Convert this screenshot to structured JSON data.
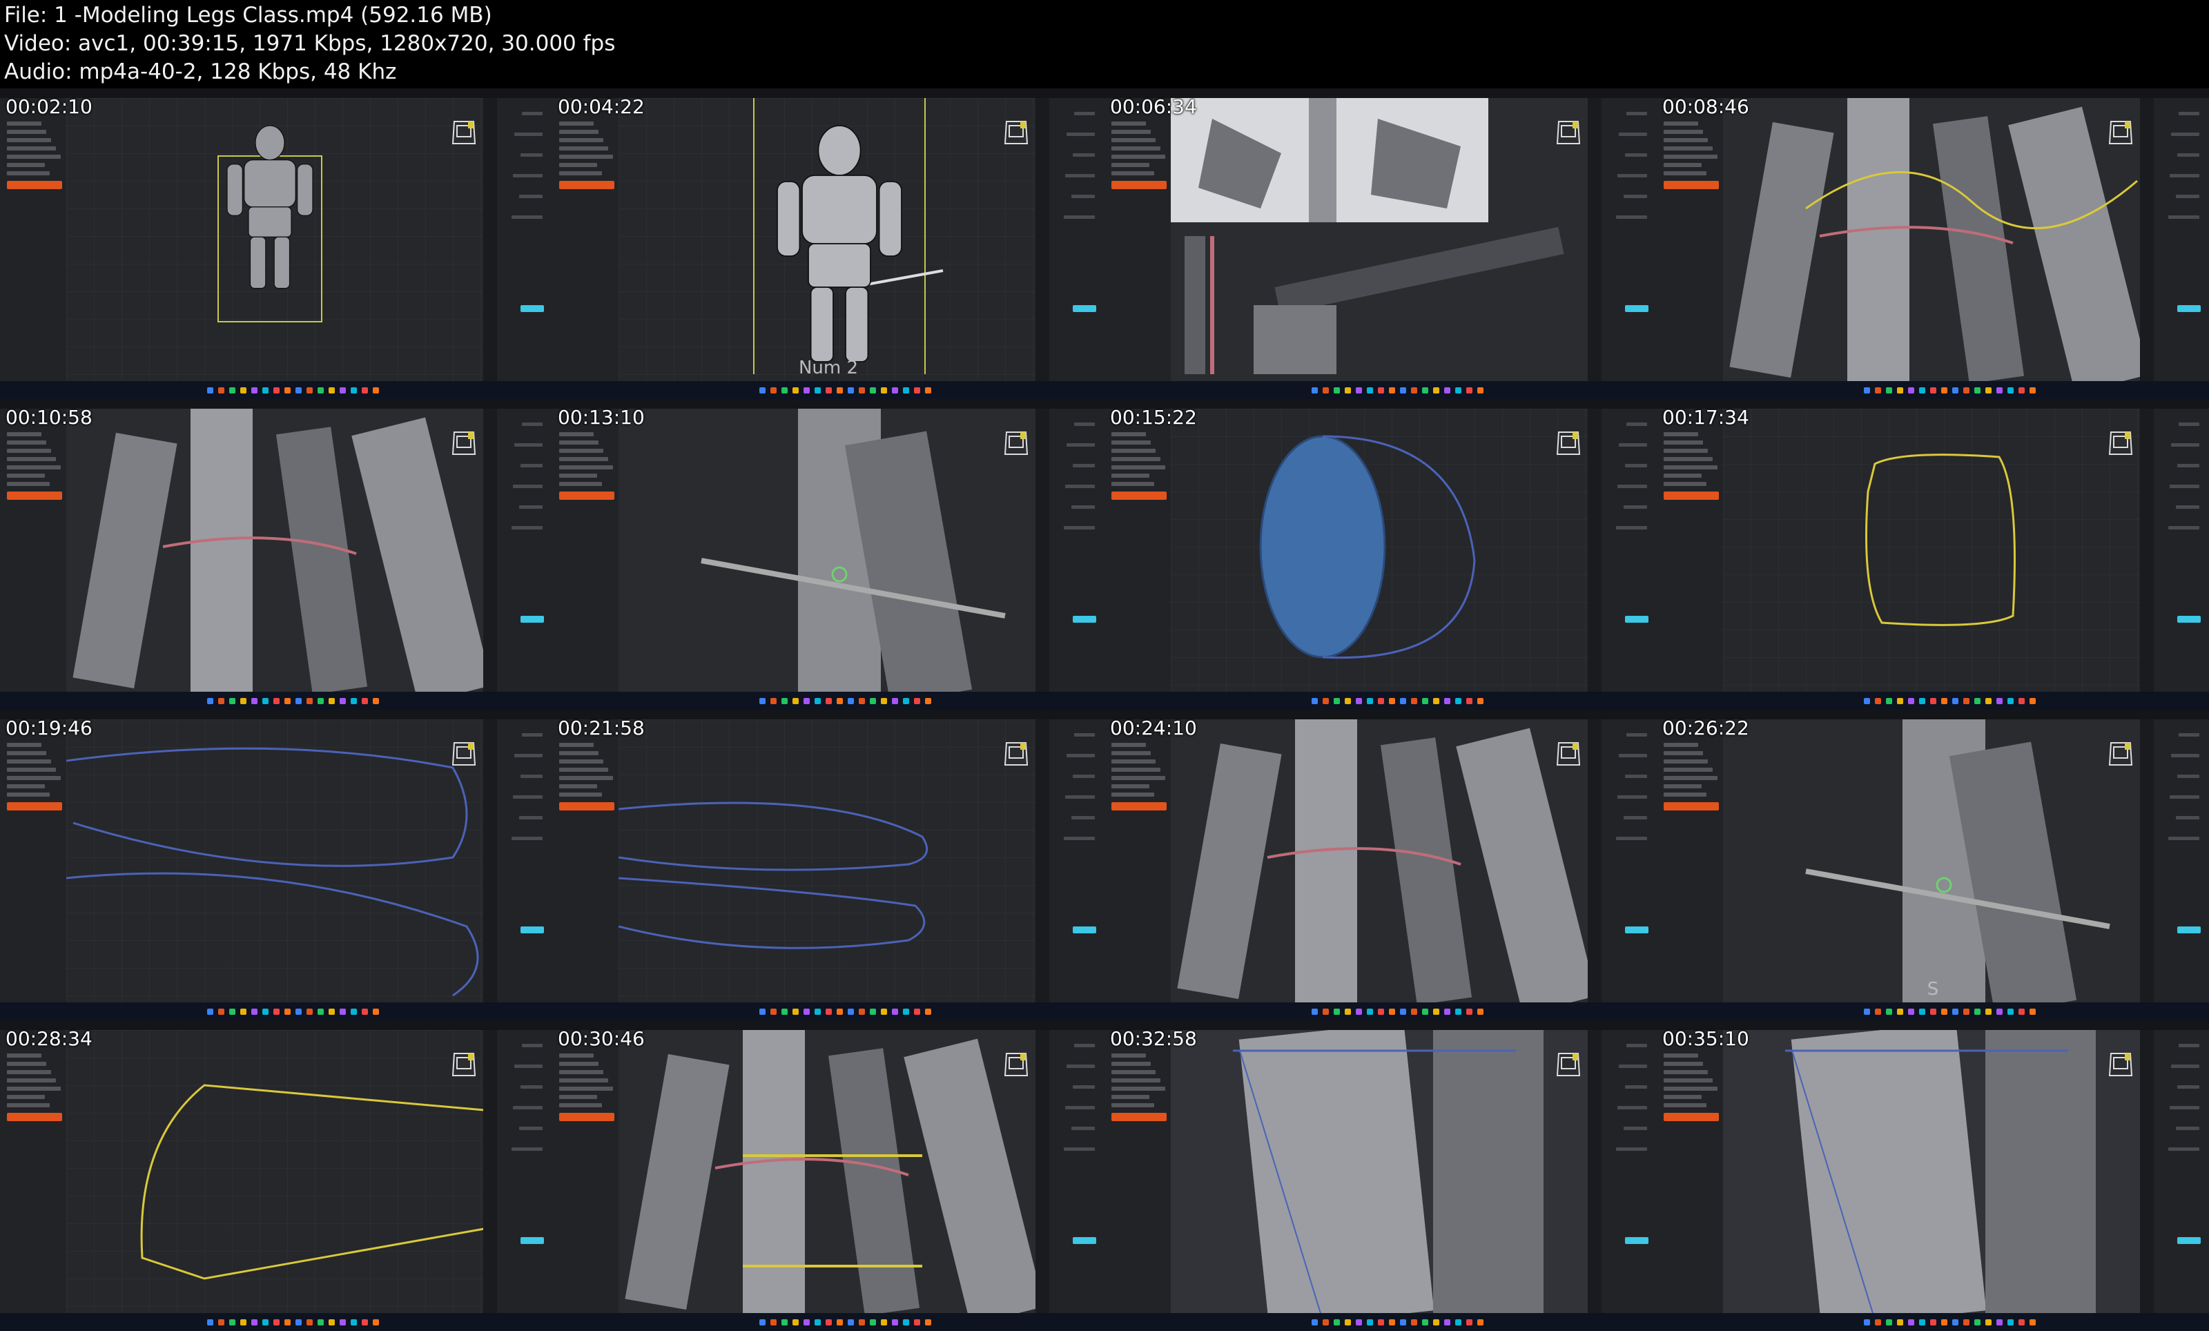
{
  "header": {
    "file_line": "File: 1 -Modeling Legs Class.mp4 (592.16 MB)",
    "video_line": "Video: avc1, 00:39:15, 1971 Kbps, 1280x720, 30.000 fps",
    "audio_line": "Audio: mp4a-40-2, 128 Kbps, 48 Khz"
  },
  "thumbnails": [
    {
      "timestamp": "00:02:10",
      "scene": "fullbody-front",
      "subtitle": ""
    },
    {
      "timestamp": "00:04:22",
      "scene": "fullbody-side",
      "subtitle": "Num 2"
    },
    {
      "timestamp": "00:06:34",
      "scene": "closeup-armor",
      "subtitle": ""
    },
    {
      "timestamp": "00:08:46",
      "scene": "arm-curve",
      "subtitle": ""
    },
    {
      "timestamp": "00:10:58",
      "scene": "torso-arms",
      "subtitle": ""
    },
    {
      "timestamp": "00:13:10",
      "scene": "arm-side",
      "subtitle": ""
    },
    {
      "timestamp": "00:15:22",
      "scene": "blue-ellipse",
      "subtitle": ""
    },
    {
      "timestamp": "00:17:34",
      "scene": "yellow-loop",
      "subtitle": ""
    },
    {
      "timestamp": "00:19:46",
      "scene": "blue-curves",
      "subtitle": ""
    },
    {
      "timestamp": "00:21:58",
      "scene": "blue-curves-2",
      "subtitle": ""
    },
    {
      "timestamp": "00:24:10",
      "scene": "waist-closeup",
      "subtitle": ""
    },
    {
      "timestamp": "00:26:22",
      "scene": "arm-side-2",
      "subtitle": "S"
    },
    {
      "timestamp": "00:28:34",
      "scene": "yellow-shape",
      "subtitle": ""
    },
    {
      "timestamp": "00:30:46",
      "scene": "legs-front",
      "subtitle": ""
    },
    {
      "timestamp": "00:32:58",
      "scene": "leg-closeup",
      "subtitle": ""
    },
    {
      "timestamp": "00:35:10",
      "scene": "leg-closeup-2",
      "subtitle": ""
    }
  ],
  "colors": {
    "accent_orange": "#e2541c",
    "accent_cyan": "#3cc8e6",
    "curve_yellow": "#d9c93a",
    "curve_blue": "#4a63b8",
    "ellipse_fill": "#3f6ea8"
  },
  "icons": {
    "view_cube": "view-cube-icon",
    "taskbar": "taskbar-app-icon"
  }
}
